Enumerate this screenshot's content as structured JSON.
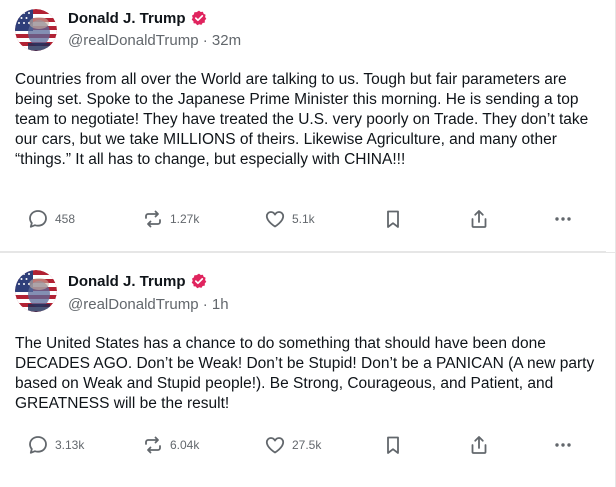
{
  "colors": {
    "verified_badge": "#e0245e",
    "text_primary": "#0f1419",
    "text_secondary": "#62676c",
    "icon": "#62676c",
    "divider": "#e6e6e6"
  },
  "posts": [
    {
      "author": {
        "display_name": "Donald J. Trump",
        "handle": "@realDonaldTrump",
        "verified": true,
        "avatar": "donald-trump-avatar"
      },
      "meta": "@realDonaldTrump · 32m",
      "text": "Countries from all over the World are talking to us. Tough but fair parameters are being set. Spoke to the Japanese Prime Minister this morning. He is sending a top team to negotiate! They have treated the U.S. very poorly on Trade. They don’t take our cars, but we take MILLIONS of theirs. Likewise Agriculture, and many other “things.” It all has to change, but especially with CHINA!!!",
      "actions": {
        "replies": "458",
        "restates": "1.27k",
        "likes": "5.1k",
        "icons": [
          "reply-icon",
          "restate-icon",
          "like-icon",
          "bookmark-icon",
          "share-icon",
          "more-icon"
        ]
      }
    },
    {
      "author": {
        "display_name": "Donald J. Trump",
        "handle": "@realDonaldTrump",
        "verified": true,
        "avatar": "donald-trump-avatar"
      },
      "meta": "@realDonaldTrump · 1h",
      "text": "The United States has a chance to do something that should have been done DECADES AGO. Don’t be Weak! Don’t be Stupid! Don’t be a PANICAN (A new party based on Weak and Stupid people!). Be Strong, Courageous, and Patient, and GREATNESS will be the result!",
      "actions": {
        "replies": "3.13k",
        "restates": "6.04k",
        "likes": "27.5k",
        "icons": [
          "reply-icon",
          "restate-icon",
          "like-icon",
          "bookmark-icon",
          "share-icon",
          "more-icon"
        ]
      }
    }
  ]
}
